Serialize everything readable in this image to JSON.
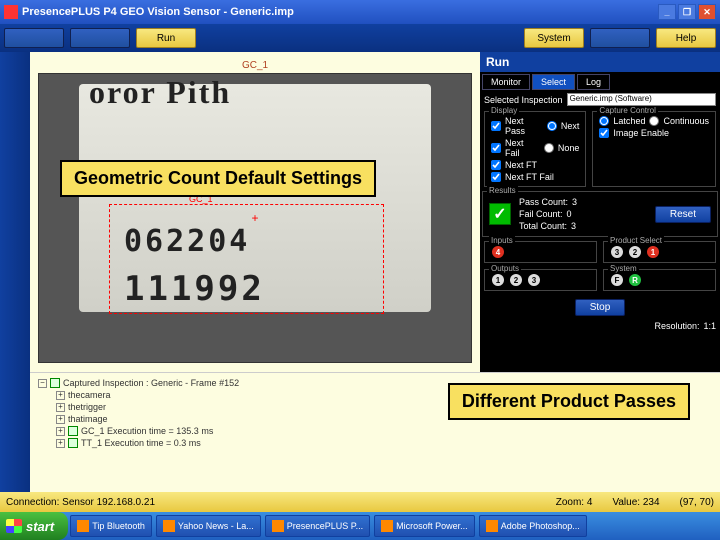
{
  "titlebar": {
    "title": "PresencePLUS P4 GEO Vision Sensor - Generic.imp"
  },
  "toolbar": {
    "btn1": "",
    "btn2": "",
    "run": "Run",
    "system": "System",
    "btn5": "",
    "help": "Help"
  },
  "camera": {
    "label": "GC_1",
    "partial_text": "oror Pith",
    "roi_label": "GC_1",
    "num1": "062204",
    "num2": "111992"
  },
  "annotations": {
    "top": "Geometric Count Default Settings",
    "bottom": "Different Product Passes"
  },
  "right": {
    "header": "Run",
    "tabs": {
      "monitor": "Monitor",
      "select": "Select",
      "log": "Log"
    },
    "inspection_label": "Selected Inspection",
    "inspection_value": "Generic.imp (Software)",
    "display": {
      "legend": "Display",
      "next_pass": "Next Pass",
      "next": "Next",
      "next_fail": "Next Fail",
      "none": "None",
      "next_ft": "Next FT",
      "next_ft_fail": "Next FT Fail"
    },
    "capture": {
      "legend": "Capture Control",
      "latched": "Latched",
      "continuous": "Continuous",
      "image_enable": "Image Enable"
    },
    "results": {
      "legend": "Results",
      "pass_count_label": "Pass Count:",
      "pass_count": "3",
      "fail_count_label": "Fail Count:",
      "fail_count": "0",
      "total_count_label": "Total Count:",
      "total_count": "3",
      "reset": "Reset"
    },
    "inputs": {
      "legend": "Inputs"
    },
    "product_select": {
      "legend": "Product Select"
    },
    "outputs": {
      "legend": "Outputs"
    },
    "system": {
      "legend": "System"
    },
    "stop": "Stop",
    "resolution_label": "Resolution:",
    "resolution": "1:1"
  },
  "tree": {
    "root": "Captured Inspection : Generic - Frame #152",
    "n1": "thecamera",
    "n2": "thetrigger",
    "n3": "thatimage",
    "n4": "GC_1 Execution time = 135.3 ms",
    "n5": "TT_1 Execution time = 0.3 ms"
  },
  "status": {
    "connection": "Connection: Sensor 192.168.0.21",
    "zoom_label": "Zoom:",
    "zoom": "4",
    "value_label": "Value:",
    "value": "234",
    "coords": "(97, 70)"
  },
  "taskbar": {
    "start": "start",
    "t1": "Tip Bluetooth",
    "t2": "Yahoo News - La...",
    "t3": "PresencePLUS P...",
    "t4": "Microsoft Power...",
    "t5": "Adobe Photoshop..."
  }
}
